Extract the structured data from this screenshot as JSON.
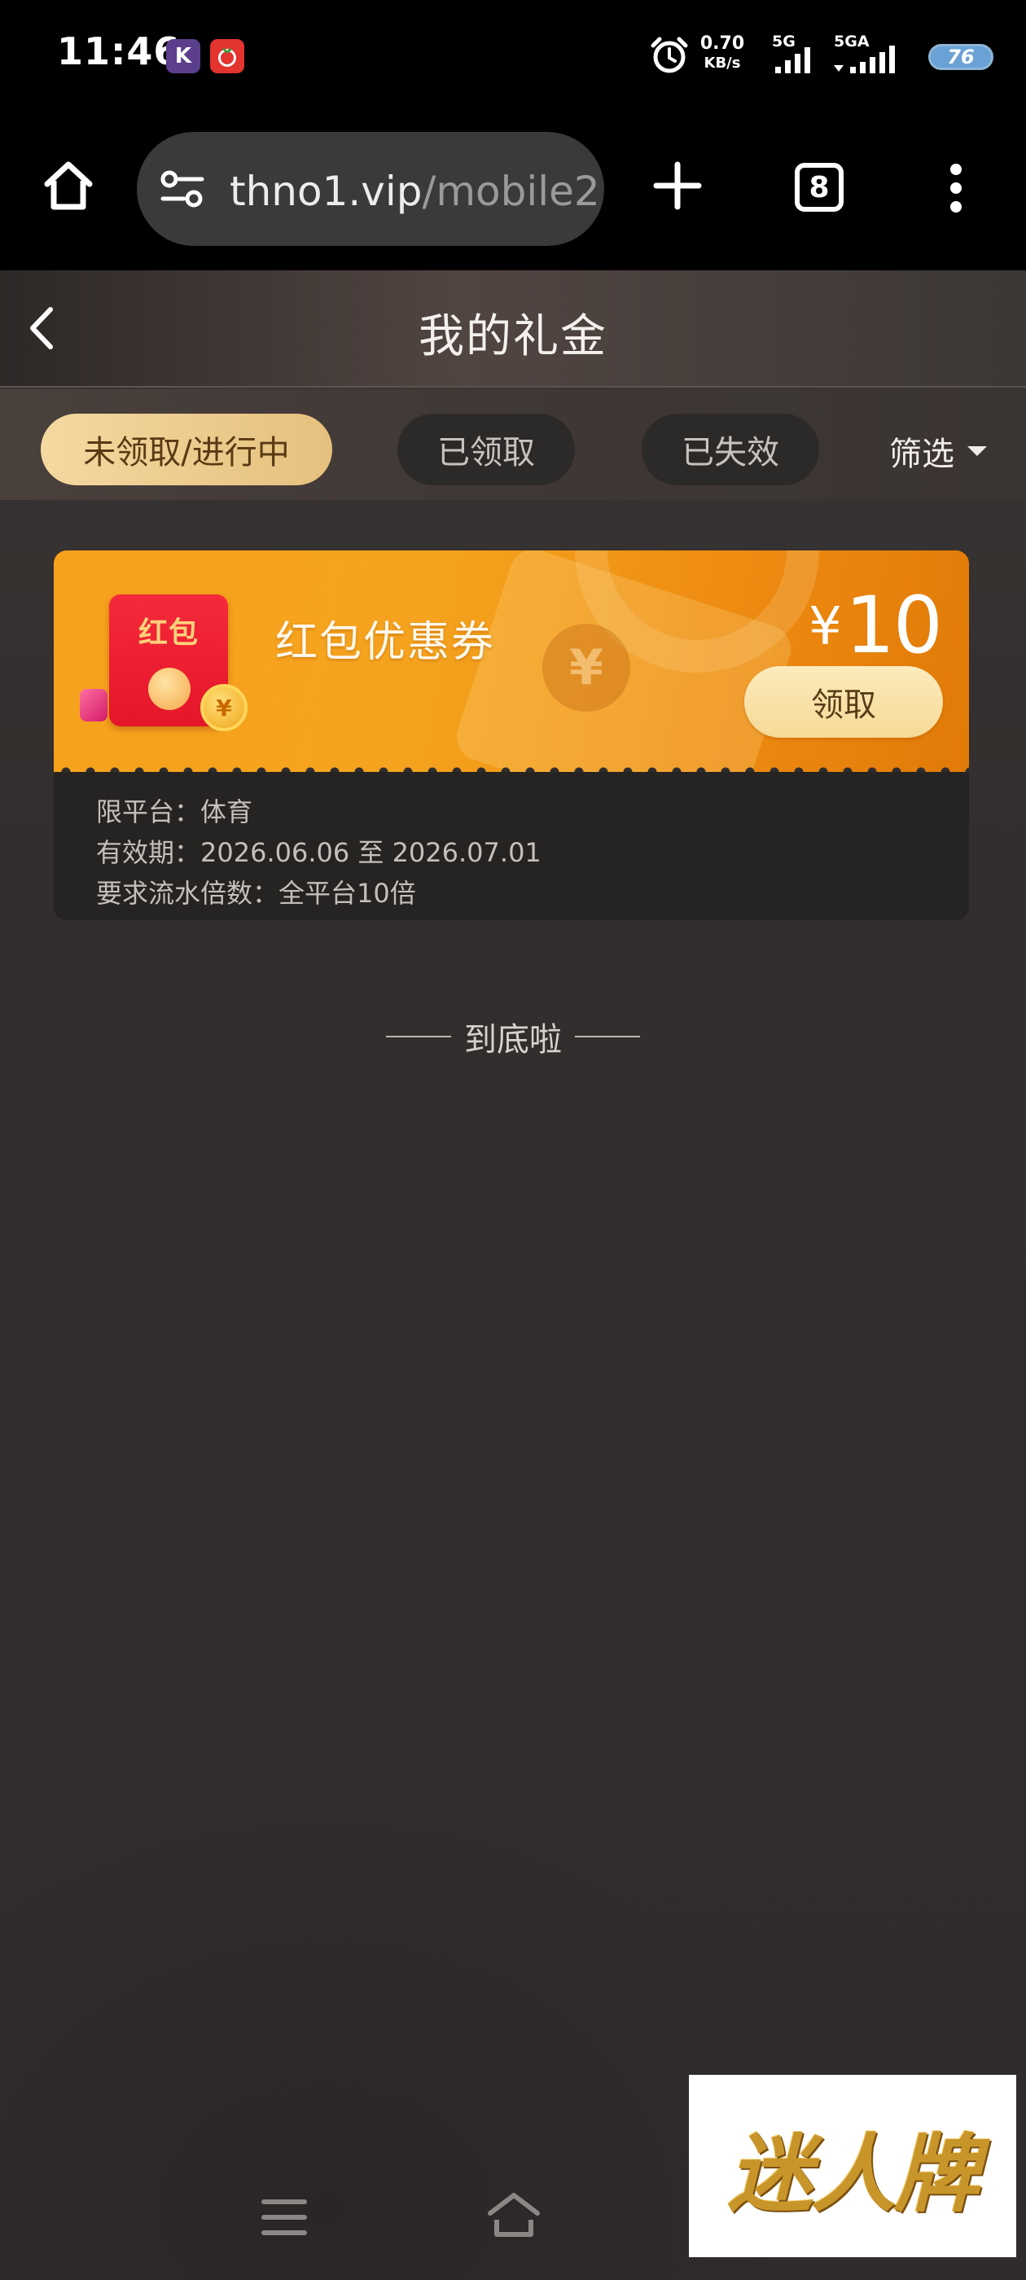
{
  "status_bar": {
    "time": "11:46",
    "net_speed_value": "0.70",
    "net_speed_unit": "KB/s",
    "signal_1_label": "5G",
    "signal_2_label": "5GA",
    "battery": "76"
  },
  "browser": {
    "url_host": "thno1.vip",
    "url_path": "/mobile2",
    "tab_count": "8"
  },
  "page": {
    "title": "我的礼金"
  },
  "tabs": [
    {
      "label": "未领取/进行中",
      "active": true
    },
    {
      "label": "已领取",
      "active": false
    },
    {
      "label": "已失效",
      "active": false
    }
  ],
  "filter": {
    "label": "筛选"
  },
  "coupon": {
    "packet_label": "红包",
    "title": "红包优惠券",
    "currency": "¥",
    "amount": "10",
    "claim_label": "领取",
    "platform": "限平台：体育",
    "validity": "有效期：2026.06.06 至 2026.07.01",
    "turnover": "要求流水倍数：全平台10倍"
  },
  "end_of_list": "到底啦",
  "watermark": "迷人牌",
  "colors": {
    "accent_gold": "#f4d9a0",
    "coupon_orange": "#f5a31e",
    "page_bg": "#2f2c2c"
  }
}
